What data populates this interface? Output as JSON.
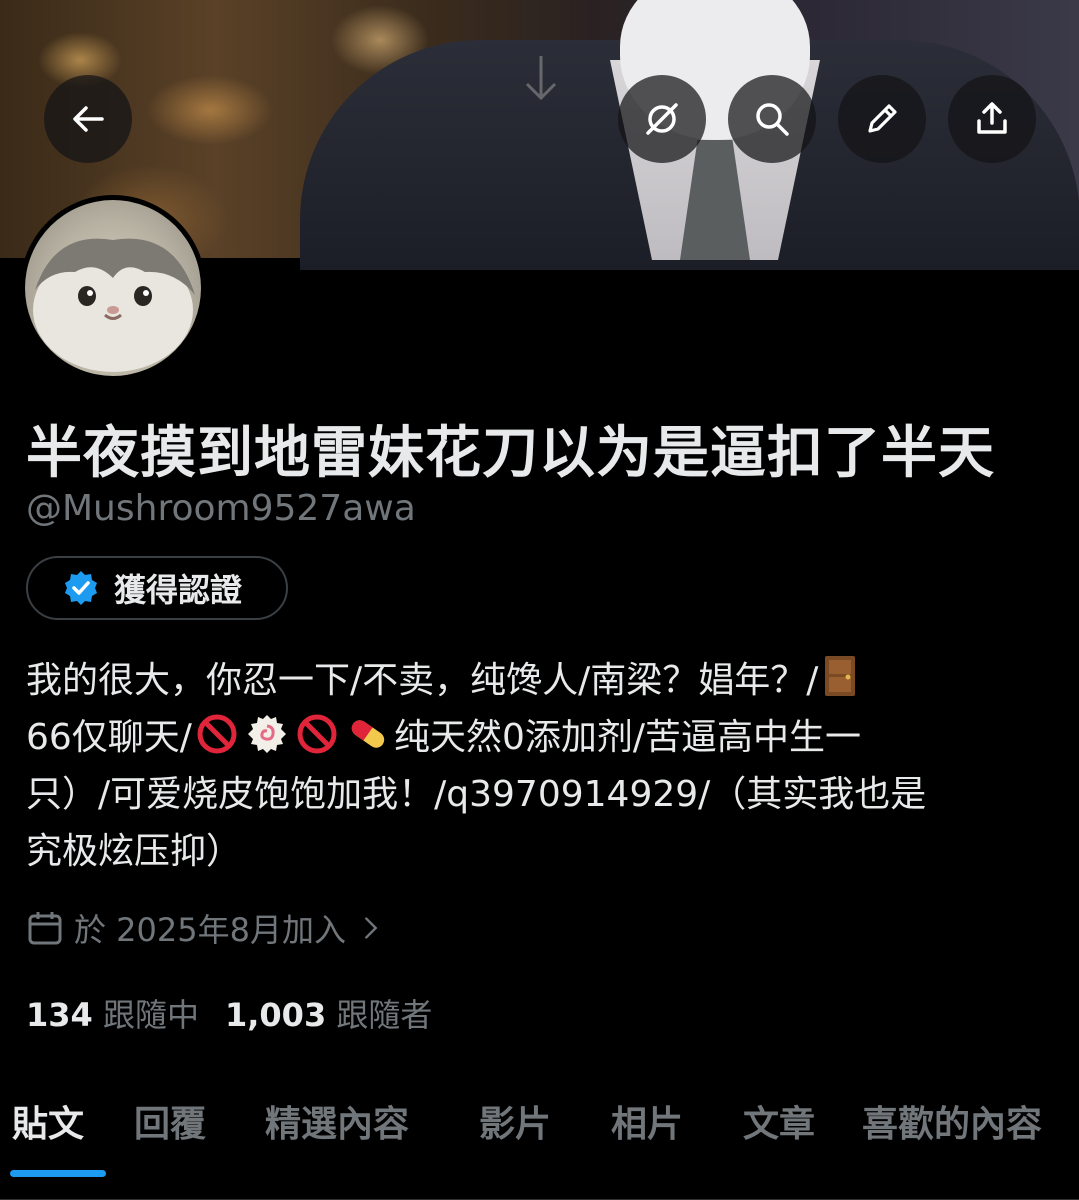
{
  "profile": {
    "display_name": "半夜摸到地雷妹花刀以为是逼扣了半天",
    "handle": "@Mushroom9527awa",
    "verify_label": "獲得認證",
    "bio_lines": [
      "我的很大，你忍一下/不卖，纯馋人/南梁？娼年？/",
      "66仅聊天/",
      "纯天然0添加剂/苦逼高中生一",
      "只）/可爱烧皮饱饱加我！/q3970914929/（其实我也是",
      "究极炫压抑）"
    ],
    "joined": "於 2025年8月加入",
    "following_count": "134",
    "following_label": "跟隨中",
    "followers_count": "1,003",
    "followers_label": "跟隨者"
  },
  "tabs": [
    {
      "label": "貼文"
    },
    {
      "label": "回覆"
    },
    {
      "label": "精選內容"
    },
    {
      "label": "影片"
    },
    {
      "label": "相片"
    },
    {
      "label": "文章"
    },
    {
      "label": "喜歡的內容"
    }
  ],
  "icons": {
    "back": "arrow-left-icon",
    "hidden": "eye-off-icon",
    "search": "search-icon",
    "edit": "pencil-icon",
    "share": "share-icon",
    "verified": "verified-badge-icon",
    "calendar": "calendar-icon",
    "chevron": "chevron-right-icon"
  },
  "colors": {
    "accent": "#1d9bf0",
    "background": "#000000",
    "text": "#e7e9ea",
    "muted": "#71767b"
  }
}
